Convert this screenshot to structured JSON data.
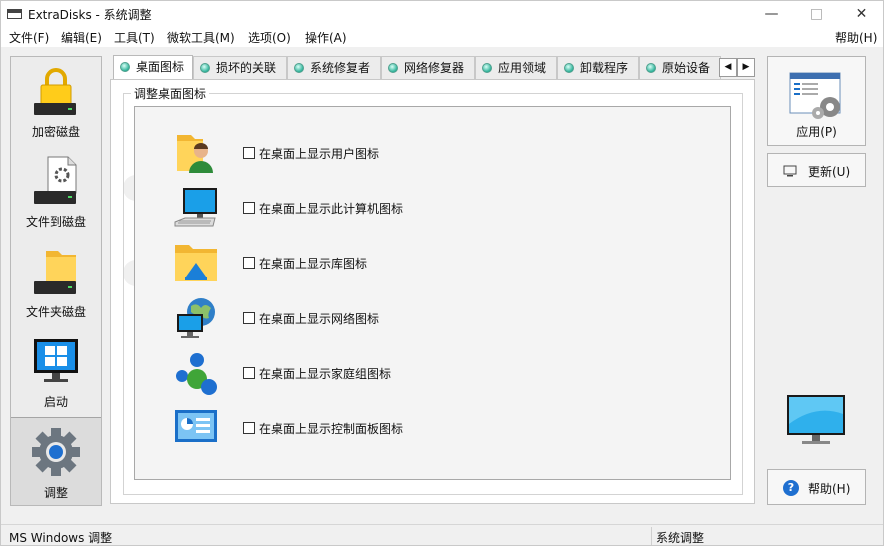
{
  "window": {
    "title": "ExtraDisks - 系统调整",
    "minimize": "—",
    "maximize": "□",
    "close": "✕"
  },
  "menu": {
    "items": [
      "文件(F)",
      "编辑(E)",
      "工具(T)",
      "微软工具(M)",
      "选项(O)",
      "操作(A)"
    ],
    "help": "帮助(H)"
  },
  "sidebar": {
    "items": [
      {
        "label": "加密磁盘",
        "icon": "lock-disk-icon"
      },
      {
        "label": "文件到磁盘",
        "icon": "file-disk-icon"
      },
      {
        "label": "文件夹磁盘",
        "icon": "folder-disk-icon"
      },
      {
        "label": "启动",
        "icon": "windows-startup-icon"
      },
      {
        "label": "调整",
        "icon": "gear-icon",
        "active": true
      }
    ]
  },
  "tabs": {
    "items": [
      "桌面图标",
      "损坏的关联",
      "系统修复者",
      "网络修复器",
      "应用领域",
      "卸载程序",
      "原始设备"
    ],
    "active_index": 0,
    "scroll_left": "◀",
    "scroll_right": "▶"
  },
  "panel": {
    "group_title": "调整桌面图标",
    "options": [
      {
        "label": "在桌面上显示用户图标",
        "icon": "user-folder-icon",
        "checked": false
      },
      {
        "label": "在桌面上显示此计算机图标",
        "icon": "computer-icon",
        "checked": false
      },
      {
        "label": "在桌面上显示库图标",
        "icon": "library-icon",
        "checked": false
      },
      {
        "label": "在桌面上显示网络图标",
        "icon": "network-icon",
        "checked": false
      },
      {
        "label": "在桌面上显示家庭组图标",
        "icon": "homegroup-icon",
        "checked": false
      },
      {
        "label": "在桌面上显示控制面板图标",
        "icon": "control-panel-icon",
        "checked": false
      }
    ]
  },
  "right": {
    "apply": "应用(P)",
    "refresh": "更新(U)",
    "help": "帮助(H)"
  },
  "status": {
    "left": "MS Windows 调整",
    "right": "系统调整"
  },
  "colors": {
    "accent": "#2fb39a",
    "help_blue": "#1e6fd0",
    "window_bg": "#f0f0f0"
  }
}
